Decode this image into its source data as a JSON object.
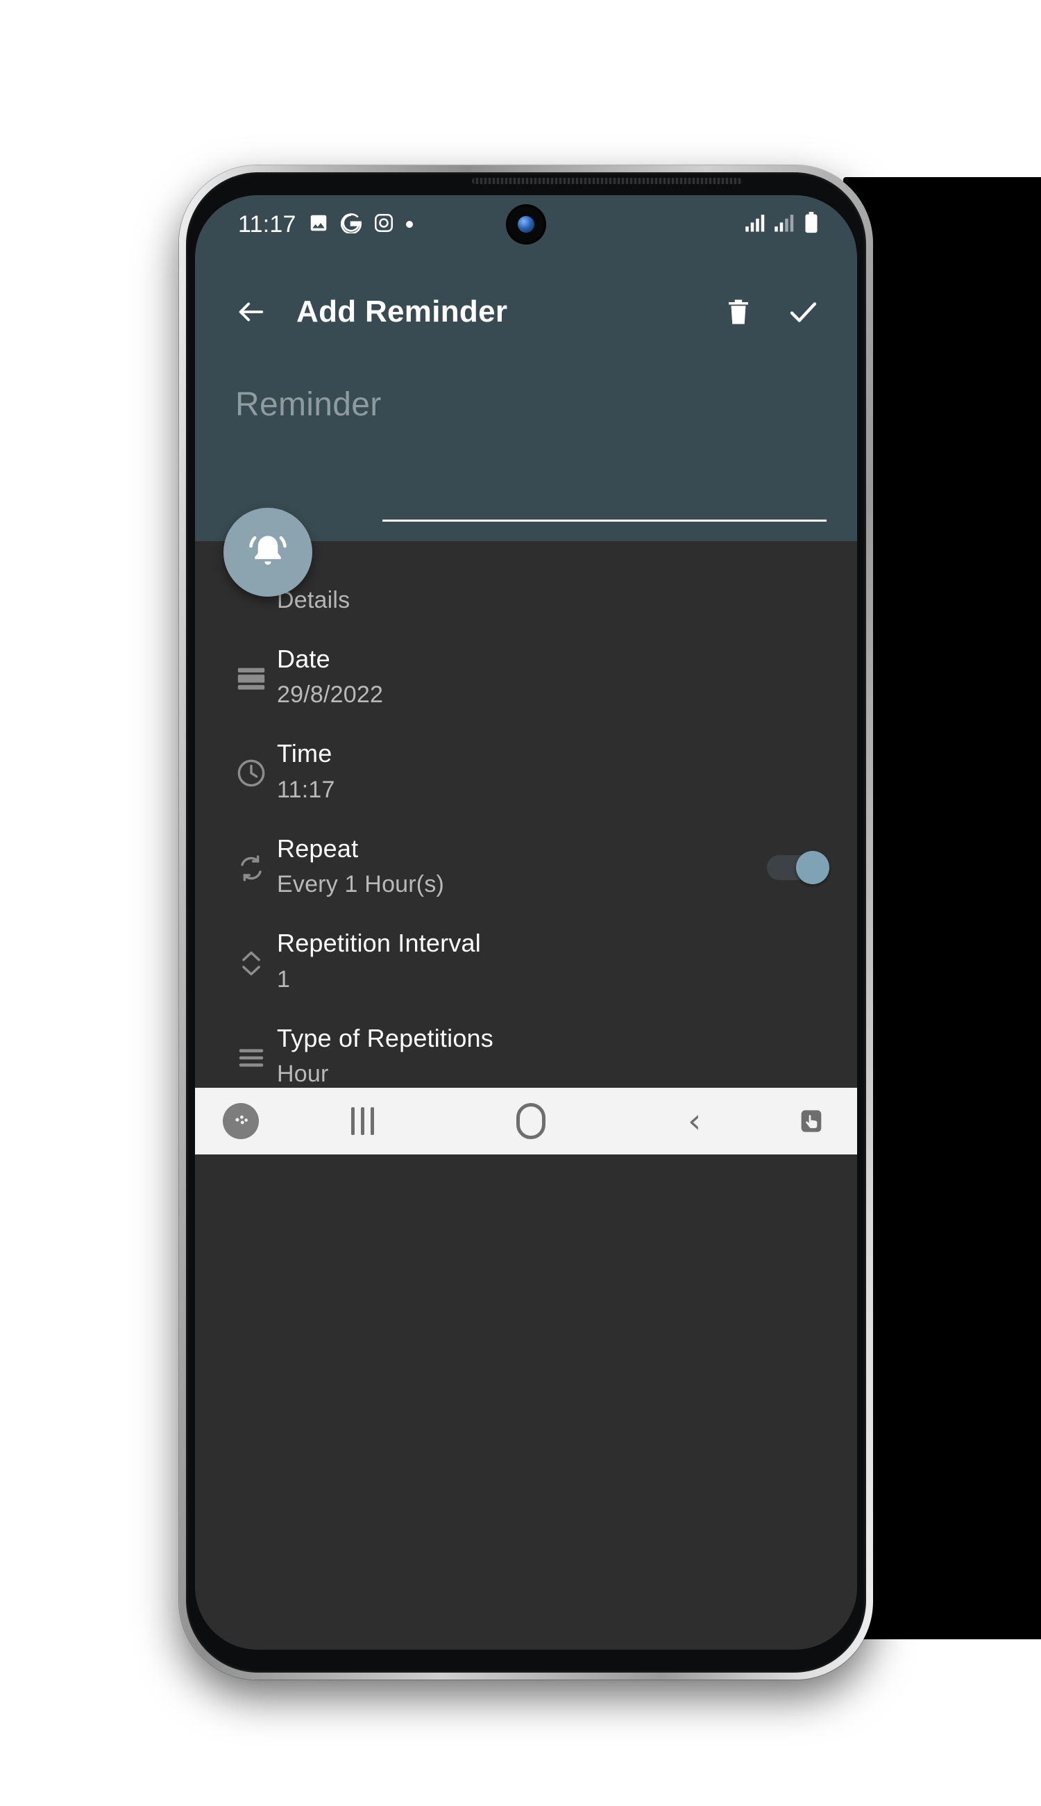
{
  "status_bar": {
    "time": "11:17",
    "left_icons": [
      "photo-icon",
      "google-g-icon",
      "instagram-icon",
      "dot-icon"
    ],
    "right_icons": [
      "signal-bars-1-icon",
      "signal-bars-2-icon",
      "battery-full-icon"
    ]
  },
  "app_bar": {
    "back_label": "back-arrow",
    "title": "Add Reminder",
    "delete_label": "delete",
    "confirm_label": "confirm"
  },
  "title_field": {
    "placeholder": "Reminder",
    "value": ""
  },
  "fab": {
    "icon": "bell-ring-icon"
  },
  "details": {
    "section_label": "Details",
    "rows": [
      {
        "icon": "calendar-icon",
        "title": "Date",
        "value": "29/8/2022",
        "control": "none"
      },
      {
        "icon": "clock-icon",
        "title": "Time",
        "value": "11:17",
        "control": "none"
      },
      {
        "icon": "repeat-icon",
        "title": "Repeat",
        "value": "Every 1 Hour(s)",
        "control": "toggle",
        "toggle_on": true
      },
      {
        "icon": "stepper-icon",
        "title": "Repetition Interval",
        "value": "1",
        "control": "none"
      },
      {
        "icon": "list-icon",
        "title": "Type of Repetitions",
        "value": "Hour",
        "control": "none"
      }
    ]
  },
  "nav_bar": {
    "items": [
      "game-booster-icon",
      "recents-icon",
      "home-icon",
      "back-icon",
      "touch-assist-icon"
    ]
  },
  "colors": {
    "header": "#394b52",
    "body": "#2e2e2e",
    "accent": "#7fa3b5",
    "fab": "#8ba4b0",
    "nav_bg": "#f3f3f3"
  }
}
